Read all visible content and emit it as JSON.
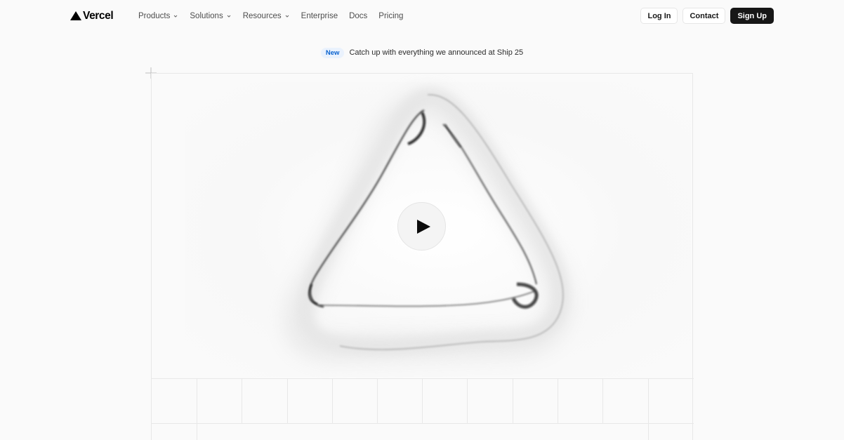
{
  "brand": {
    "name": "Vercel",
    "logo_icon": "vercel-triangle-icon"
  },
  "nav": {
    "items": [
      {
        "label": "Products",
        "has_dropdown": true
      },
      {
        "label": "Solutions",
        "has_dropdown": true
      },
      {
        "label": "Resources",
        "has_dropdown": true
      },
      {
        "label": "Enterprise",
        "has_dropdown": false
      },
      {
        "label": "Docs",
        "has_dropdown": false
      },
      {
        "label": "Pricing",
        "has_dropdown": false
      }
    ]
  },
  "actions": {
    "login": "Log In",
    "contact": "Contact",
    "signup": "Sign Up"
  },
  "announcement": {
    "badge": "New",
    "text": "Catch up with everything we announced at Ship 25"
  },
  "hero": {
    "play_icon": "play-icon"
  },
  "colors": {
    "background": "#fafafa",
    "text": "#171717",
    "badge_text": "#0a63cf",
    "badge_bg": "#eaf2fd",
    "border": "#e8e8e8"
  }
}
